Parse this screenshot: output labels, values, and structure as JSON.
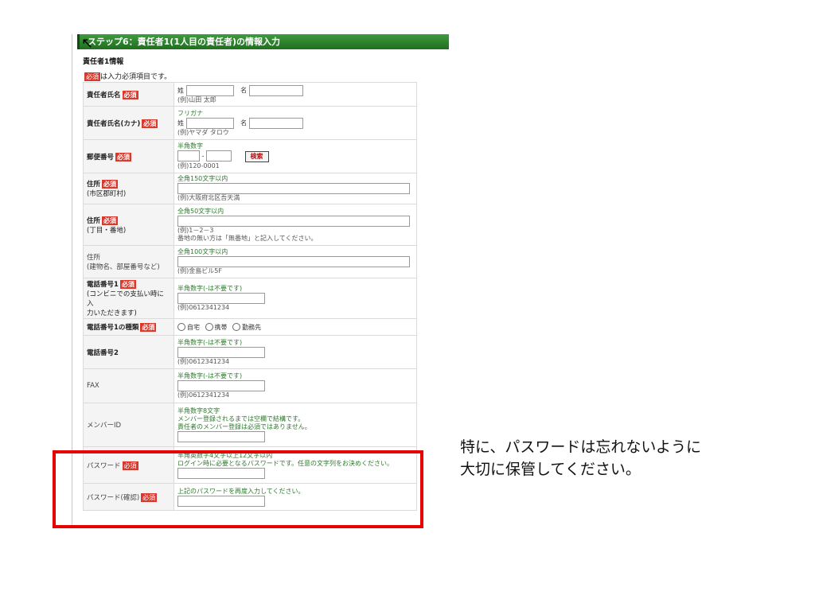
{
  "step_title": "ステップ6：責任者1(1人目の責任者)の情報入力",
  "section_title": "責任者1情報",
  "required_badge": "必須",
  "required_note": "は入力必須項目です。",
  "rows": {
    "name": {
      "label": "責任者氏名",
      "sei": "姓",
      "mei": "名",
      "example": "(例)山田 太郎"
    },
    "kana": {
      "label": "責任者氏名(カナ)",
      "furigana": "フリガナ",
      "sei": "姓",
      "mei": "名",
      "example": "(例)ヤマダ タロウ"
    },
    "zip": {
      "label": "郵便番号",
      "hint": "半角数字",
      "dash": "-",
      "search_button": "検索",
      "example": "(例)120-0001"
    },
    "addr1": {
      "label": "住所",
      "label2": "(市区郡町村)",
      "hint": "全角150文字以内",
      "example": "(例)大阪府北区吾天満"
    },
    "addr2": {
      "label": "住所",
      "label2": "(丁目・番地)",
      "hint": "全角50文字以内",
      "example": "(例)1－2－3",
      "example2": "番地の無い方は「無番地」と記入してください。"
    },
    "addr3": {
      "label": "住所",
      "label2": "(建物名、部屋番号など)",
      "hint": "全角100文字以内",
      "example": "(例)金島ビル5F"
    },
    "tel1": {
      "label": "電話番号1",
      "label2": "(コンビニでの支払い時に入",
      "label3": "力いただきます)",
      "hint": "半角数字(-は不要です)",
      "example": "(例)0612341234"
    },
    "tel1_type": {
      "label": "電話番号1の種類",
      "opt1": "自宅",
      "opt2": "携帯",
      "opt3": "勤務先"
    },
    "tel2": {
      "label": "電話番号2",
      "hint": "半角数字(-は不要です)",
      "example": "(例)0612341234"
    },
    "fax": {
      "label": "FAX",
      "hint": "半角数字(-は不要です)",
      "example": "(例)0612341234"
    },
    "member": {
      "label": "メンバーID",
      "hint": "半角数字8文字",
      "hint2": "メンバー登録されるまでは空欄で結構です。",
      "hint3": "責任者のメンバー登録は必須ではありません。"
    },
    "password": {
      "label": "パスワード",
      "hint": "半角英数字4文字以上12文字以内",
      "hint2": "ログイン時に必要となるパスワードです。任意の文字列をお決めください。"
    },
    "password_confirm": {
      "label": "パスワード(確認)",
      "hint": "上記のパスワードを再度入力してください。"
    }
  },
  "caption_line1": "特に、パスワードは忘れないように",
  "caption_line2": "大切に保管してください。",
  "colors": {
    "step_bar": "#2e852e",
    "badge": "#d9382c",
    "highlight": "#e60000",
    "hint": "#2d7a2d"
  }
}
